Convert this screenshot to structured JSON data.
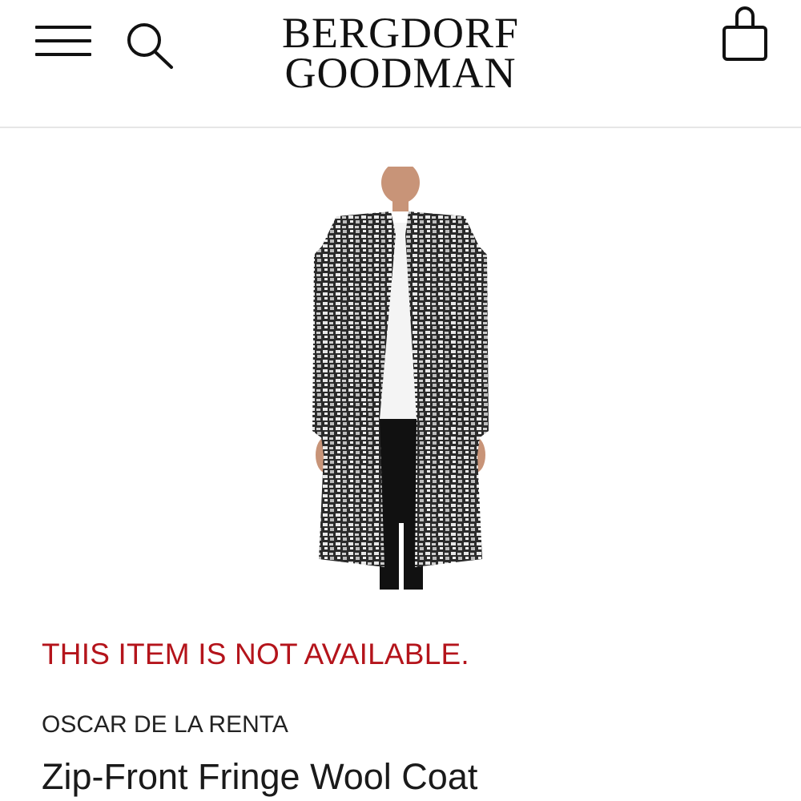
{
  "header": {
    "logo_line1": "BERGDORF",
    "logo_line2": "GOODMAN",
    "menu_icon": "hamburger-menu-icon",
    "search_icon": "search-icon",
    "bag_icon": "shopping-bag-icon"
  },
  "product": {
    "availability": "THIS ITEM IS NOT AVAILABLE.",
    "designer": "OSCAR DE LA RENTA",
    "name": "Zip-Front Fringe Wool Coat",
    "image_alt": "Zip-Front Fringe Wool Coat"
  },
  "colors": {
    "alert": "#b4141b",
    "text": "#1a1a1a",
    "divider": "#e6e6e6"
  }
}
